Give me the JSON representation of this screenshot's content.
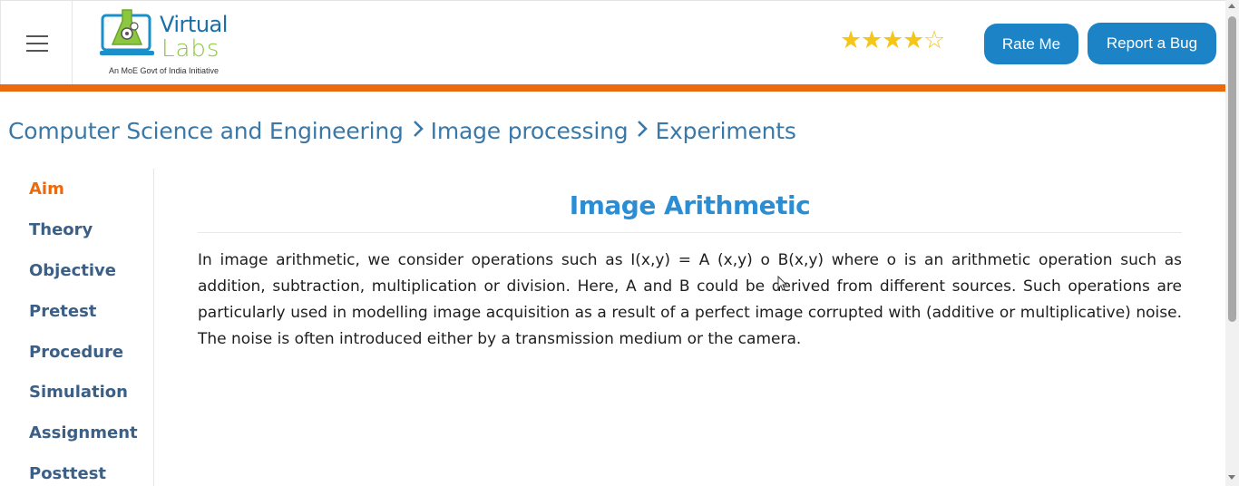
{
  "header": {
    "logo": {
      "line1": "Virtual",
      "line2": "Labs",
      "tagline": "An MoE Govt of India Initiative"
    },
    "rating": {
      "value": 4,
      "max": 5,
      "star_color": "#f5c518"
    },
    "rate_label": "Rate Me",
    "bug_label": "Report a Bug"
  },
  "colors": {
    "accent_orange": "#ec6a0e",
    "button_blue": "#1c84c6",
    "link_blue": "#3a78a8",
    "title_blue": "#2b8ed4"
  },
  "breadcrumb": {
    "items": [
      "Computer Science and Engineering",
      "Image processing",
      "Experiments"
    ]
  },
  "sidebar": {
    "items": [
      {
        "label": "Aim",
        "active": true
      },
      {
        "label": "Theory"
      },
      {
        "label": "Objective"
      },
      {
        "label": "Pretest"
      },
      {
        "label": "Procedure"
      },
      {
        "label": "Simulation"
      },
      {
        "label": "Assignment"
      },
      {
        "label": "Posttest"
      }
    ]
  },
  "main": {
    "title": "Image Arithmetic",
    "body": "In image arithmetic, we consider operations such as I(x,y) = A (x,y) o B(x,y) where o is an arithmetic operation such as addition, subtraction, multiplication or division. Here, A and B could be derived from different sources. Such operations are particularly used in modelling image acquisition as a result of a perfect image corrupted with (additive or multiplicative) noise. The noise is often introduced either by a transmission medium or the camera."
  },
  "icons": {
    "menu": "hamburger-icon",
    "breadcrumb_separator": "chevron-right-icon",
    "star_full": "star-filled-icon",
    "star_empty": "star-outline-icon"
  }
}
